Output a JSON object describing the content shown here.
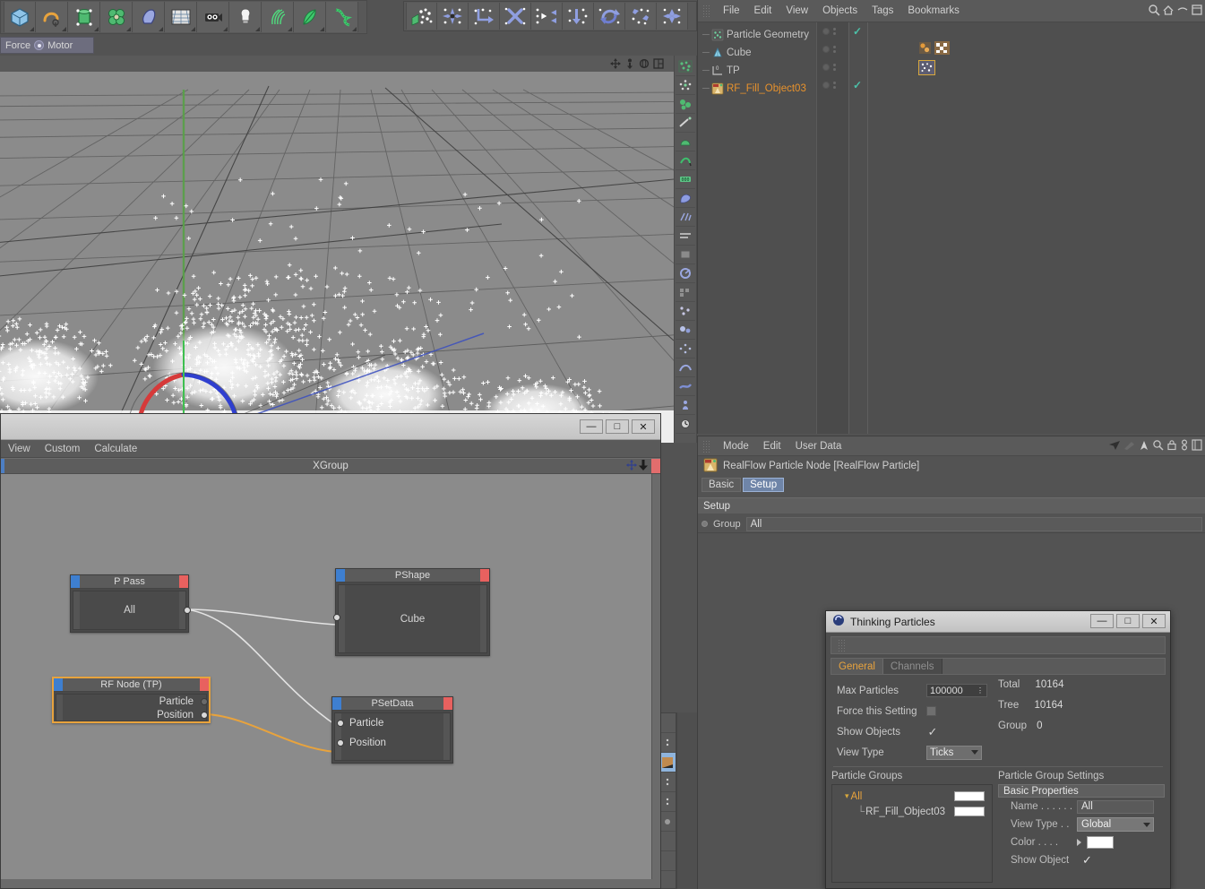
{
  "app": {
    "title": "Cinema 4D"
  },
  "toolbar_top_left": {
    "buttons": [
      {
        "name": "cube-object-icon",
        "label": "Cube"
      },
      {
        "name": "spline-object-icon",
        "label": "Spline"
      },
      {
        "name": "generator-object-icon",
        "label": "Generator"
      },
      {
        "name": "deformer-object-icon",
        "label": "Deformer"
      },
      {
        "name": "environment-object-icon",
        "label": "Environment"
      },
      {
        "name": "floor-object-icon",
        "label": "Floor"
      },
      {
        "name": "camera-object-icon",
        "label": "Camera"
      },
      {
        "name": "light-object-icon",
        "label": "Light"
      },
      {
        "name": "hair-object-icon",
        "label": "Hair"
      },
      {
        "name": "feather-object-icon",
        "label": "Feather"
      },
      {
        "name": "hairtool-object-icon",
        "label": "Hair Tools"
      }
    ]
  },
  "force_motor": {
    "force_label": "Force",
    "motor_label": "Motor"
  },
  "toolbar_particles": {
    "buttons": [
      {
        "name": "emitter-icon",
        "label": "Emitter"
      },
      {
        "name": "attractor-icon",
        "label": "Attractor"
      },
      {
        "name": "deflector-icon",
        "label": "Deflector"
      },
      {
        "name": "destructor-icon",
        "label": "Destructor"
      },
      {
        "name": "friction-icon",
        "label": "Friction"
      },
      {
        "name": "gravity-icon",
        "label": "Gravity"
      },
      {
        "name": "rotation-icon",
        "label": "Rotation"
      },
      {
        "name": "turbulence-icon",
        "label": "Turbulence"
      },
      {
        "name": "wind-icon",
        "label": "Wind"
      }
    ]
  },
  "viewport": {
    "header_icons": [
      {
        "name": "pan-view-icon"
      },
      {
        "name": "dolly-view-icon"
      },
      {
        "name": "rotate-view-icon"
      },
      {
        "name": "layout-view-icon"
      }
    ]
  },
  "vertical_toolbar": {
    "buttons": [
      {
        "name": "particle-emitter-tool-icon"
      },
      {
        "name": "particle-group-tool-icon"
      },
      {
        "name": "particle-geometry-tool-icon"
      },
      {
        "name": "particle-draw-tool-icon"
      },
      {
        "name": "particle-cloth-tool-icon"
      },
      {
        "name": "particle-paint-tool-icon"
      },
      {
        "name": "particle-cache-tool-icon"
      },
      {
        "name": "soft-body-tool-icon"
      },
      {
        "name": "dynamics-tool-icon"
      },
      {
        "name": "connector-tool-icon"
      },
      {
        "name": "thinking-particles-tool-icon"
      },
      {
        "name": "xpresso-tool-icon"
      },
      {
        "name": "mograph-tool-icon"
      },
      {
        "name": "effector-tool-icon"
      },
      {
        "name": "cloner-tool-icon"
      },
      {
        "name": "field-tool-icon"
      },
      {
        "name": "shader-tool-icon"
      },
      {
        "name": "simulate-tool-icon"
      },
      {
        "name": "character-tool-icon"
      },
      {
        "name": "clock-tool-icon"
      }
    ]
  },
  "object_manager": {
    "menu": [
      "File",
      "Edit",
      "View",
      "Objects",
      "Tags",
      "Bookmarks"
    ],
    "right_icons": [
      {
        "name": "search-icon"
      },
      {
        "name": "home-icon"
      },
      {
        "name": "minimize-icon"
      },
      {
        "name": "expand-icon"
      }
    ],
    "rows": [
      {
        "label": "Particle Geometry",
        "icon": "particle-geometry-icon",
        "selected": false,
        "check": true,
        "tags": []
      },
      {
        "label": "Cube",
        "icon": "cube-icon",
        "selected": false,
        "check": false,
        "tags": [
          "material-tag",
          "checker-texture-tag"
        ]
      },
      {
        "label": "TP",
        "icon": "tp-null-icon",
        "selected": false,
        "check": false,
        "tags": [
          "thinking-particles-tag"
        ]
      },
      {
        "label": "RF_Fill_Object03",
        "icon": "realflow-icon",
        "selected": true,
        "check": true,
        "tags": []
      }
    ]
  },
  "attribute_manager": {
    "menu": [
      "Mode",
      "Edit",
      "User Data"
    ],
    "right_icons": [
      {
        "name": "pin-arrow-icon"
      },
      {
        "name": "pen-icon"
      },
      {
        "name": "up-arrow-icon"
      },
      {
        "name": "search-icon"
      },
      {
        "name": "lock-icon"
      },
      {
        "name": "key-icon"
      },
      {
        "name": "panel-icon"
      }
    ],
    "object_title": "RealFlow Particle Node [RealFlow Particle]",
    "object_icon": "realflow-icon",
    "tabs": [
      {
        "label": "Basic",
        "active": false
      },
      {
        "label": "Setup",
        "active": true
      }
    ],
    "section_title": "Setup",
    "group_label": "Group",
    "group_value": "All"
  },
  "xpresso": {
    "window_buttons": [
      {
        "name": "minimize-button",
        "glyph": "—"
      },
      {
        "name": "maximize-button",
        "glyph": "□"
      },
      {
        "name": "close-button",
        "glyph": "✕"
      }
    ],
    "menu": [
      "View",
      "Custom",
      "Calculate"
    ],
    "group_header": "XGroup",
    "group_header_icons": [
      {
        "name": "move-group-icon"
      },
      {
        "name": "collapse-group-icon"
      }
    ],
    "nodes": [
      {
        "id": "p-pass",
        "title": "P Pass",
        "center_label": "All",
        "selected": false,
        "outputs": [
          "All"
        ],
        "inputs": []
      },
      {
        "id": "pshape",
        "title": "PShape",
        "center_label": "Cube",
        "selected": false,
        "outputs": [],
        "inputs": [
          "Cube"
        ]
      },
      {
        "id": "rf-node-tp",
        "title": "RF Node (TP)",
        "center_label": "",
        "selected": true,
        "outputs": [
          "Particle",
          "Position"
        ],
        "inputs": []
      },
      {
        "id": "psetdata",
        "title": "PSetData",
        "center_label": "",
        "selected": false,
        "outputs": [],
        "inputs": [
          "Particle",
          "Position"
        ]
      }
    ]
  },
  "thinking_particles": {
    "title": "Thinking Particles",
    "window_buttons": [
      {
        "name": "minimize-button",
        "glyph": "—"
      },
      {
        "name": "maximize-button",
        "glyph": "□"
      },
      {
        "name": "close-button",
        "glyph": "✕"
      }
    ],
    "tabs": [
      {
        "label": "General",
        "active": true
      },
      {
        "label": "Channels",
        "active": false
      }
    ],
    "general": {
      "max_particles_label": "Max Particles",
      "max_particles_value": "100000",
      "force_this_setting_label": "Force this Setting",
      "force_this_setting_checked": false,
      "show_objects_label": "Show Objects",
      "show_objects_checked": true,
      "view_type_label": "View Type",
      "view_type_value": "Ticks",
      "total_label": "Total",
      "total_value": "10164",
      "tree_label": "Tree",
      "tree_value": "10164",
      "group_label": "Group",
      "group_value": "0"
    },
    "particle_groups_label": "Particle Groups",
    "particle_group_settings_label": "Particle Group Settings",
    "groups": [
      {
        "label": "All",
        "selected": true,
        "indent": 0,
        "color": "#ffffff"
      },
      {
        "label": "RF_Fill_Object03",
        "selected": false,
        "indent": 1,
        "color": "#ffffff"
      }
    ],
    "basic_properties": {
      "header": "Basic Properties",
      "name_label": "Name . . . . . .",
      "name_value": "All",
      "view_type_label": "View Type . .",
      "view_type_value": "Global",
      "color_label": "Color . . . .",
      "color_value": "#ffffff",
      "show_object_label": "Show Object",
      "show_object_checked": true
    }
  },
  "colors": {
    "accent_orange": "#e8a33d",
    "node_port_blue": "#3e7fd0",
    "node_port_red": "#e8615f",
    "wire_white": "#e0e0e0",
    "wire_orange": "#e8a33d",
    "check_teal": "#4cc0a8",
    "tab_blue": "#6f85a8",
    "axis_green": "#5aa04a"
  }
}
